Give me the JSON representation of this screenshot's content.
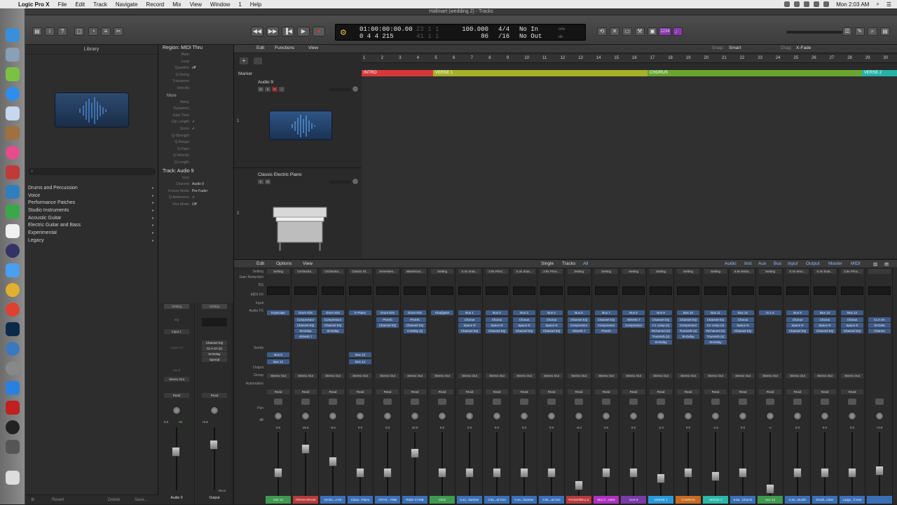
{
  "menubar": {
    "apple": "",
    "app": "Logic Pro X",
    "menus": [
      "File",
      "Edit",
      "Track",
      "Navigate",
      "Record",
      "Mix",
      "View",
      "Window",
      "1",
      "Help"
    ],
    "datetime": "Mon 2:03 AM"
  },
  "window": {
    "title": "Hallmart (wedding 2) - Tracks"
  },
  "lcd": {
    "position": "01:00:00:00.00",
    "bars": "0 4 4 215",
    "dim1": "23  1  1",
    "dim2": "41  1  1",
    "tempo": "100.000",
    "tempo_sub": "86",
    "sig": "4/4",
    "sig_sub": "/16",
    "in": "No In",
    "out": "No Out",
    "cpu": "CPU",
    "hd": "HD"
  },
  "library": {
    "title": "Library",
    "search_placeholder": "",
    "categories": [
      "Drums and Percussion",
      "Voice",
      "Performance Patches",
      "Studio Instruments",
      "Acoustic Guitar",
      "Electric Guitar and Bass",
      "Experimental",
      "Legacy"
    ],
    "revert": "Revert",
    "delete": "Delete",
    "save": "Save..."
  },
  "inspector": {
    "region_header": "Region: MIDI Thru",
    "region_rows": [
      {
        "k": "Mute:",
        "v": ""
      },
      {
        "k": "Loop:",
        "v": ""
      },
      {
        "k": "Quantize:",
        "v": "off"
      },
      {
        "k": "Q-Swing:",
        "v": ""
      },
      {
        "k": "Transpose:",
        "v": ""
      },
      {
        "k": "Velocity:",
        "v": ""
      }
    ],
    "more": "More",
    "more_rows": [
      {
        "k": "Delay:",
        "v": ""
      },
      {
        "k": "Dynamics:",
        "v": ""
      },
      {
        "k": "Gate Time:",
        "v": ""
      },
      {
        "k": "Clip Length:",
        "v": "✓"
      },
      {
        "k": "Score:",
        "v": "✓"
      },
      {
        "k": "Q-Strength:",
        "v": ""
      },
      {
        "k": "Q-Range:",
        "v": ""
      },
      {
        "k": "Q-Flam:",
        "v": ""
      },
      {
        "k": "Q-Velocity:",
        "v": ""
      },
      {
        "k": "Q-Length:",
        "v": ""
      }
    ],
    "track_header": "Track: Audio 9",
    "track_rows": [
      {
        "k": "Icon:",
        "v": ""
      },
      {
        "k": "Channel:",
        "v": "Audio 9"
      },
      {
        "k": "Freeze Mode:",
        "v": "Pre Fader"
      },
      {
        "k": "Q-Reference:",
        "v": "✓"
      },
      {
        "k": "Flex Mode:",
        "v": "Off"
      }
    ],
    "strip1": {
      "setting": "Setting",
      "eq": "EQ",
      "input": "Input 1",
      "fx": "Audio FX",
      "send": "Send",
      "output": "Stereo Out",
      "read": "Read",
      "db": "0.0",
      "peak": "-63",
      "name": "Audio 9"
    },
    "strip2": {
      "setting": "Setting",
      "fx": [
        "Channel EQ",
        "CLA-2A (s)",
        "St-Delay",
        "Spread"
      ],
      "read": "Read",
      "db": "+0.9",
      "name": "Output",
      "mode": "Bnce"
    }
  },
  "tracks": {
    "toolbar": {
      "edit": "Edit",
      "functions": "Functions",
      "view": "View",
      "snap_label": "Snap:",
      "snap": "Smart",
      "drag_label": "Drag:",
      "drag": "X-Fade"
    },
    "ruler": [
      "1",
      "2",
      "3",
      "4",
      "5",
      "6",
      "7",
      "8",
      "9",
      "10",
      "11",
      "12",
      "13",
      "14",
      "15",
      "16",
      "17",
      "18",
      "19",
      "20",
      "21",
      "22",
      "23",
      "24",
      "25",
      "26",
      "27",
      "28",
      "29",
      "30"
    ],
    "marker_label": "Marker",
    "markers": [
      {
        "label": "INTRO",
        "color": "#d9383a"
      },
      {
        "label": "VERSE 1",
        "color": "#a6b22a"
      },
      {
        "label": "CHORUS",
        "color": "#6aa62f"
      },
      {
        "label": "VERSE 2",
        "color": "#24b3a7"
      }
    ],
    "track1": {
      "num": "1",
      "name": "Audio 9"
    },
    "track2": {
      "num": "2",
      "name": "Classic Electric Piano"
    }
  },
  "mixer": {
    "toolbar": {
      "edit": "Edit",
      "options": "Options",
      "view": "View",
      "single": "Single",
      "tracks": "Tracks",
      "all": "All",
      "filters": [
        "Audio",
        "Inst",
        "Aux",
        "Bus",
        "Input",
        "Output",
        "Master",
        "MIDI"
      ]
    },
    "row_labels": {
      "setting": "Setting",
      "gain": "Gain Reduction",
      "eq": "EQ",
      "midifx": "MIDI FX",
      "input": "Input",
      "audiofx": "Audio FX",
      "sends": "Sends",
      "output": "Output",
      "group": "Group",
      "automation": "Automation",
      "pan": "Pan",
      "db": "dB"
    },
    "strips": [
      {
        "setting": "Setting",
        "input": "Keyscape",
        "fx": [],
        "sends": [
          "Bus 8",
          "Bus 12"
        ],
        "output": "Stereo Out",
        "auto": "Read",
        "db": "0.0",
        "name": "Inst 13",
        "color": "#3f9a4f",
        "fader": 0.35
      },
      {
        "setting": "Orchestra...",
        "input": "Drum Kits",
        "fx": [
          "Compressor",
          "Channel EQ",
          "St-Delay",
          "AltiVerb 7"
        ],
        "sends": [],
        "output": "Stereo Out",
        "auto": "Read",
        "db": "15.6",
        "name": "TIPANI DRUM",
        "color": "#b83a3a",
        "fader": 0.78
      },
      {
        "setting": "Orchestra...",
        "input": "Drum Kits",
        "fx": [
          "Compressor",
          "Channel EQ",
          "St-Delay"
        ],
        "sends": [],
        "output": "Stereo Out",
        "auto": "Read",
        "db": "-6.6",
        "name": "Orche...n Kit",
        "color": "#3a6fb8",
        "fader": 0.55
      },
      {
        "setting": "Classic El...",
        "input": "E-Piano",
        "fx": [],
        "sends": [
          "Bus 13",
          "Bus 14"
        ],
        "output": "Stereo Out",
        "auto": "Read",
        "db": "0.0",
        "name": "Class...Piano",
        "color": "#3a6fb8",
        "fader": 0.35
      },
      {
        "setting": "Seventies...",
        "input": "Drum Kits",
        "fx": [
          "PtVerb",
          "Channel EQ"
        ],
        "sends": [],
        "output": "Stereo Out",
        "auto": "Read",
        "db": "0.0",
        "name": "CRAS...YMB",
        "color": "#3a6fb8",
        "fader": 0.35
      },
      {
        "setting": "Warehous...",
        "input": "Drum Kits",
        "fx": [
          "PtVerb",
          "Channel EQ",
          "H-Delay (s)"
        ],
        "sends": [],
        "output": "Stereo Out",
        "auto": "Read",
        "db": "10.6",
        "name": "RIDE-CYMB",
        "color": "#3a6fb8",
        "fader": 0.7
      },
      {
        "setting": "Setting",
        "input": "Klopfgeist",
        "fx": [],
        "sends": [],
        "output": "Stereo Out",
        "auto": "Read",
        "db": "0.0",
        "name": "Click",
        "color": "#3f9a4f",
        "fader": 0.35
      },
      {
        "setting": "0.4s Snar...",
        "input": "Bus 1",
        "fx": [
          "Chorus",
          "Space D",
          "Channel EQ"
        ],
        "sends": [],
        "output": "Stereo Out",
        "auto": "Read",
        "db": "0.0",
        "name": "0.4s...hamber",
        "color": "#3a6fb8",
        "fader": 0.35
      },
      {
        "setting": "3.9s Princ...",
        "input": "Bus 2",
        "fx": [
          "Chorus",
          "Space D",
          "Channel EQ"
        ],
        "sends": [],
        "output": "Stereo Out",
        "auto": "Read",
        "db": "0.0",
        "name": "3.9s...al One",
        "color": "#3a6fb8",
        "fader": 0.35
      },
      {
        "setting": "0.4s Snar...",
        "input": "Bus 3",
        "fx": [
          "Chorus",
          "Space D",
          "Channel EQ"
        ],
        "sends": [],
        "output": "Stereo Out",
        "auto": "Read",
        "db": "0.0",
        "name": "0.4s...hamber",
        "color": "#3a6fb8",
        "fader": 0.35
      },
      {
        "setting": "3.9s Princ...",
        "input": "Bus 4",
        "fx": [
          "Chorus",
          "Space D",
          "Channel EQ"
        ],
        "sends": [],
        "output": "Stereo Out",
        "auto": "Read",
        "db": "0.0",
        "name": "3.9s...al One",
        "color": "#3a6fb8",
        "fader": 0.35
      },
      {
        "setting": "Setting",
        "input": "Bus 5",
        "fx": [
          "Channel EQ",
          "Compressor",
          "AltiVerb 7"
        ],
        "sends": [],
        "output": "Stereo Out",
        "auto": "Read",
        "db": "-8.4",
        "name": "PIANO/BELLS",
        "color": "#b83a3a",
        "fader": 0.12
      },
      {
        "setting": "Setting",
        "input": "Bus 7",
        "fx": [
          "Channel EQ",
          "Compressor",
          "PtVerb"
        ],
        "sends": [],
        "output": "Stereo Out",
        "auto": "Read",
        "db": "0.0",
        "name": "MULT...UMS",
        "color": "#b030c0",
        "fader": 0.35
      },
      {
        "setting": "Setting",
        "input": "Bus 6",
        "fx": [
          "AltiVerb 7",
          "Compressor"
        ],
        "sends": [],
        "output": "Stereo Out",
        "auto": "Read",
        "db": "0.0",
        "name": "AUX 6",
        "color": "#7a3aa8",
        "fader": 0.35
      },
      {
        "setting": "Setting",
        "input": "Bus 9",
        "fx": [
          "Channel EQ",
          "C1 comp (s)",
          "RChannel (s)",
          "TrueVerb (s)",
          "St-Delay"
        ],
        "sends": [],
        "output": "Stereo Out",
        "auto": "Read",
        "db": "-2.3",
        "name": "VERSE 1",
        "color": "#2a9ad8",
        "fader": 0.25
      },
      {
        "setting": "Setting",
        "input": "Bus 10",
        "fx": [
          "Channel EQ",
          "Compressor",
          "TrueVerb (s)",
          "St-Delay"
        ],
        "sends": [],
        "output": "Stereo Out",
        "auto": "Read",
        "db": "0.0",
        "name": "CHORUS",
        "color": "#c86a20",
        "fader": 0.35
      },
      {
        "setting": "Setting",
        "input": "Bus 11",
        "fx": [
          "Channel EQ",
          "C1 comp (s)",
          "RChannel (s)",
          "TrueVerb (s)",
          "St-Delay"
        ],
        "sends": [],
        "output": "Stereo Out",
        "auto": "Read",
        "db": "-1.5",
        "name": "VERSE 2",
        "color": "#2ab8a8",
        "fader": 0.28
      },
      {
        "setting": "6.6s Botta...",
        "input": "Bus 12",
        "fx": [
          "Chorus",
          "Space D",
          "Channel EQ"
        ],
        "sends": [],
        "output": "Stereo Out",
        "auto": "Read",
        "db": "0.0",
        "name": "6.6s...Church",
        "color": "#3a6fb8",
        "fader": 0.35
      },
      {
        "setting": "Setting",
        "input": "In 1-2",
        "fx": [],
        "sends": [],
        "output": "Stereo Out",
        "auto": "Read",
        "db": "-∞",
        "name": "Aux 12",
        "color": "#3f9a4f",
        "fader": 0.05
      },
      {
        "setting": "0.4s Woo...",
        "input": "Bus 8",
        "fx": [
          "Chorus",
          "Space D",
          "Channel EQ"
        ],
        "sends": [],
        "output": "Stereo Out",
        "auto": "Read",
        "db": "0.0",
        "name": "0.4s...Booth",
        "color": "#3a6fb8",
        "fader": 0.35
      },
      {
        "setting": "0.4s Snar...",
        "input": "Bus 13",
        "fx": [
          "Chorus",
          "Space D",
          "Channel EQ"
        ],
        "sends": [],
        "output": "Stereo Out",
        "auto": "Read",
        "db": "0.0",
        "name": "Small...mber",
        "color": "#3a6fb8",
        "fader": 0.35
      },
      {
        "setting": "3.9s Princ...",
        "input": "Bus 14",
        "fx": [
          "Chorus",
          "Space D",
          "Channel EQ"
        ],
        "sends": [],
        "output": "Stereo Out",
        "auto": "Read",
        "db": "0.0",
        "name": "Large...ll One",
        "color": "#3a6fb8",
        "fader": 0.35
      },
      {
        "setting": "",
        "input": "",
        "fx": [
          "CLA-2A",
          "St-Dela",
          "Channe"
        ],
        "sends": [],
        "output": "",
        "auto": "",
        "db": "+0.9",
        "name": "",
        "color": "#3a6fb8",
        "fader": 0.38
      }
    ]
  },
  "colors": {
    "accent_blue": "#3f5c88",
    "bg": "#2b2b2b",
    "lcd_bg": "#141414"
  }
}
